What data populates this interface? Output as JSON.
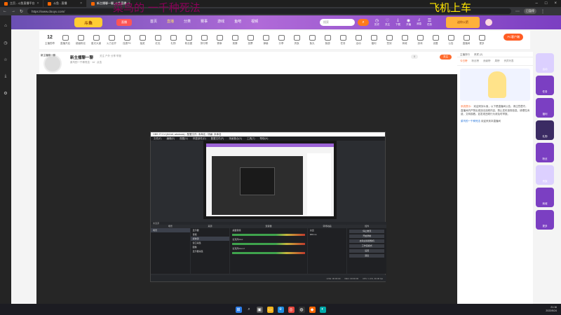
{
  "browser": {
    "tabs": [
      {
        "title": "主页 - 斗鱼直播平台",
        "active": false
      },
      {
        "title": "斗鱼 - 直播",
        "active": false
      },
      {
        "title": "新主播聊一聊_斗鱼直播",
        "active": true
      }
    ],
    "url": "https://www.douyu.com/",
    "profile_badge": "已暂停"
  },
  "overlay_text": {
    "left": "菜鸟的 一千种死法",
    "right": "飞机上车"
  },
  "site": {
    "logo": "斗鱼",
    "logo_badge": "直播",
    "nav": [
      {
        "label": "首页",
        "active": false
      },
      {
        "label": "直播",
        "active": true
      },
      {
        "label": "分类",
        "active": false
      },
      {
        "label": "赛事",
        "active": false
      },
      {
        "label": "游戏",
        "active": false
      },
      {
        "label": "鱼吧",
        "active": false
      },
      {
        "label": "视频",
        "active": false
      }
    ],
    "search_placeholder": "搜索",
    "top_icons": [
      "历史",
      "关注",
      "下载",
      "开播",
      "消息",
      "任务"
    ],
    "promo": "送你火箭"
  },
  "categories": {
    "first": {
      "num": "12",
      "label": "主播勋章"
    },
    "items": [
      "直播开启",
      "超级粉丝",
      "星光大道",
      "火力全开",
      "连麦PK",
      "抽奖",
      "红包",
      "礼物",
      "粉丝团",
      "排行榜",
      "赛事",
      "竞猜",
      "投票",
      "弹幕",
      "分享",
      "贵族",
      "鱼丸",
      "鱼翅",
      "任务",
      "活动",
      "福利",
      "签到",
      "商城",
      "游戏",
      "设置",
      "公告",
      "直播间",
      "更多"
    ],
    "pc_button": "PC客户端"
  },
  "room": {
    "avatar_label": "新主播聊一聊",
    "title": "新主播聊一聊",
    "meta": "关注  户外  分享  举报",
    "subtitle": "菜鸟的一千种死法 · 14  · 点击",
    "badge": "新人",
    "tags": [
      {
        "label": "开播",
        "style": "o"
      },
      {
        "label": "新主播扶持",
        "style": "p"
      },
      {
        "label": "新人主播认证",
        "style": "v"
      }
    ],
    "follow": "关注",
    "follow_count": "0",
    "report": "举报 1",
    "actions": [
      "分享",
      "客户端"
    ]
  },
  "obs": {
    "title": "OBS 27.2.4 (64-bit, windows) - 配置文件: 未命名 - 场景: 未命名",
    "menu": [
      "文件(F)",
      "编辑(E)",
      "视图(V)",
      "停靠部件(D)",
      "配置文件(P)",
      "场景集合(S)",
      "工具(T)",
      "帮助(H)"
    ],
    "source_bar": "未选源",
    "panels": {
      "scenes": {
        "title": "场景",
        "items": [
          "场景"
        ]
      },
      "sources": {
        "title": "来源",
        "items": [
          "显示器",
          "音频",
          "媒体源",
          "窗口采集",
          "图像",
          "显示器采集"
        ]
      },
      "mixer": {
        "title": "混音器",
        "items": [
          "桌面音频",
          "麦克风/Aux",
          "麦克风/Aux 2"
        ]
      },
      "transitions": {
        "title": "转场动画",
        "type": "淡出",
        "duration": "300 ms"
      },
      "controls": {
        "title": "控件",
        "buttons": [
          "停止推流",
          "开始录制",
          "启动虚拟摄像机",
          "工作室模式",
          "设置",
          "退出"
        ]
      }
    },
    "status": [
      "LIVE: 00:00:00",
      "REC: 00:00:00",
      "CPU: 1.1%, 30.00 fps"
    ]
  },
  "chat": {
    "header": [
      "主播排行",
      "贵宾 (2)"
    ],
    "tabs": [
      "今日榜",
      "粉丝榜",
      "贡献榜",
      "周榜",
      "贵宾列表"
    ],
    "messages": [
      {
        "name": "系统提示：",
        "text": "欢迎来到斗鱼，以下是直播间公告，请注意遵守。直播间内严禁出现违法违规内容，禁止发布违规信息。请理性消费，文明观看。如发现违规行为请及时举报。"
      },
      {
        "name": "菜鸟的一千种死法",
        "text": "欢迎来到本直播间"
      }
    ]
  },
  "rail": [
    "活动",
    "任务",
    "福利",
    "礼物",
    "粉丝",
    "贵族",
    "商城",
    "更多"
  ],
  "taskbar": {
    "time": "21:16",
    "date": "2022/5/24"
  }
}
